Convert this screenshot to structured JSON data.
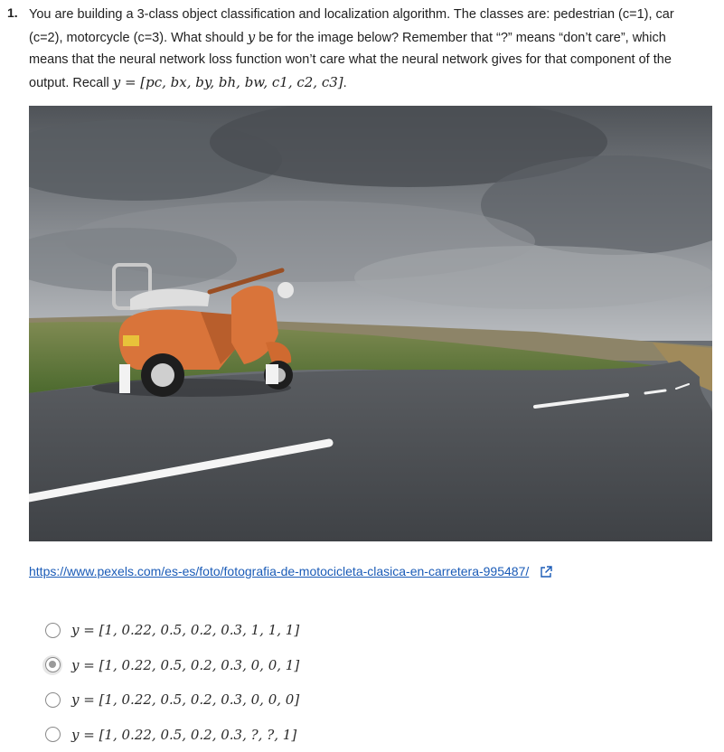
{
  "question": {
    "number": "1.",
    "text_part1": "You are building a 3-class object classification and localization algorithm. The classes are: pedestrian (c=1), car (c=2), motorcycle (c=3). What should ",
    "y_symbol": "y",
    "text_part2": " be for the image below? Remember that “?” means “don’t care”, which means that the neural network loss function won’t care what the neural network gives for that component of the output. Recall ",
    "recall_formula": "y = [pc, bx, by, bh, bw, c1, c2, c3]",
    "text_end": "."
  },
  "image": {
    "alt": "Orange vintage scooter parked on a road under cloudy sky",
    "colors": {
      "sky": "#8a8e93",
      "road": "#4d5054",
      "grass": "#5e7a3a",
      "scooter": "#d9743a"
    }
  },
  "link": {
    "url_text": "https://www.pexels.com/es-es/foto/fotografia-de-motocicleta-clasica-en-carretera-995487/",
    "icon": "external-link-icon"
  },
  "options": [
    {
      "label": "y = [1, 0.22, 0.5, 0.2, 0.3, 1, 1, 1]",
      "selected": false
    },
    {
      "label": "y = [1, 0.22, 0.5, 0.2, 0.3, 0, 0, 1]",
      "selected": true
    },
    {
      "label": "y = [1, 0.22, 0.5, 0.2, 0.3, 0, 0, 0]",
      "selected": false
    },
    {
      "label": "y = [1, 0.22, 0.5, 0.2, 0.3, ?, ?, 1]",
      "selected": false
    }
  ]
}
